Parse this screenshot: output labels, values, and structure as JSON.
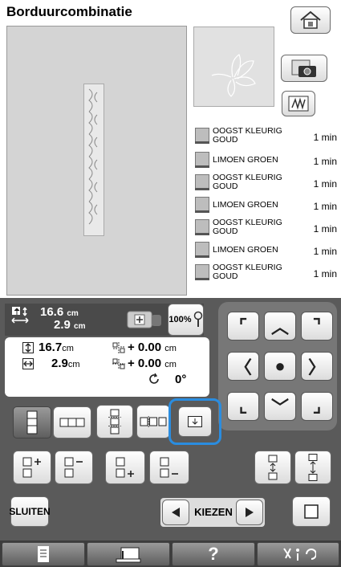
{
  "header": {
    "title": "Borduurcombinatie"
  },
  "threads": [
    {
      "name": "OOGST KLEURIG GOUD",
      "time": "1 min"
    },
    {
      "name": "LIMOEN GROEN",
      "time": "1 min"
    },
    {
      "name": "OOGST KLEURIG GOUD",
      "time": "1 min"
    },
    {
      "name": "LIMOEN GROEN",
      "time": "1 min"
    },
    {
      "name": "OOGST KLEURIG GOUD",
      "time": "1 min"
    },
    {
      "name": "LIMOEN GROEN",
      "time": "1 min"
    },
    {
      "name": "OOGST KLEURIG GOUD",
      "time": "1 min"
    }
  ],
  "size": {
    "width_label": "16.6",
    "width_unit": "cm",
    "height_label": "2.9",
    "height_unit": "cm",
    "zoom": "100%"
  },
  "info": {
    "height_value": "16.7",
    "height_unit": "cm",
    "width_value": "2.9",
    "width_unit": "cm",
    "offset_v": "+ 0.00",
    "offset_v_unit": "cm",
    "offset_h": "+ 0.00",
    "offset_h_unit": "cm",
    "rotation": "0°"
  },
  "buttons": {
    "close": "SLUITEN",
    "select": "KIEZEN"
  },
  "colors": {
    "panel": "#5a5a5a",
    "highlight": "#2a8de0"
  },
  "icons": [
    "home-icon",
    "camera-icon",
    "stitch-icon",
    "page-icon",
    "sewing-machine-icon",
    "help-icon",
    "settings-icon"
  ]
}
